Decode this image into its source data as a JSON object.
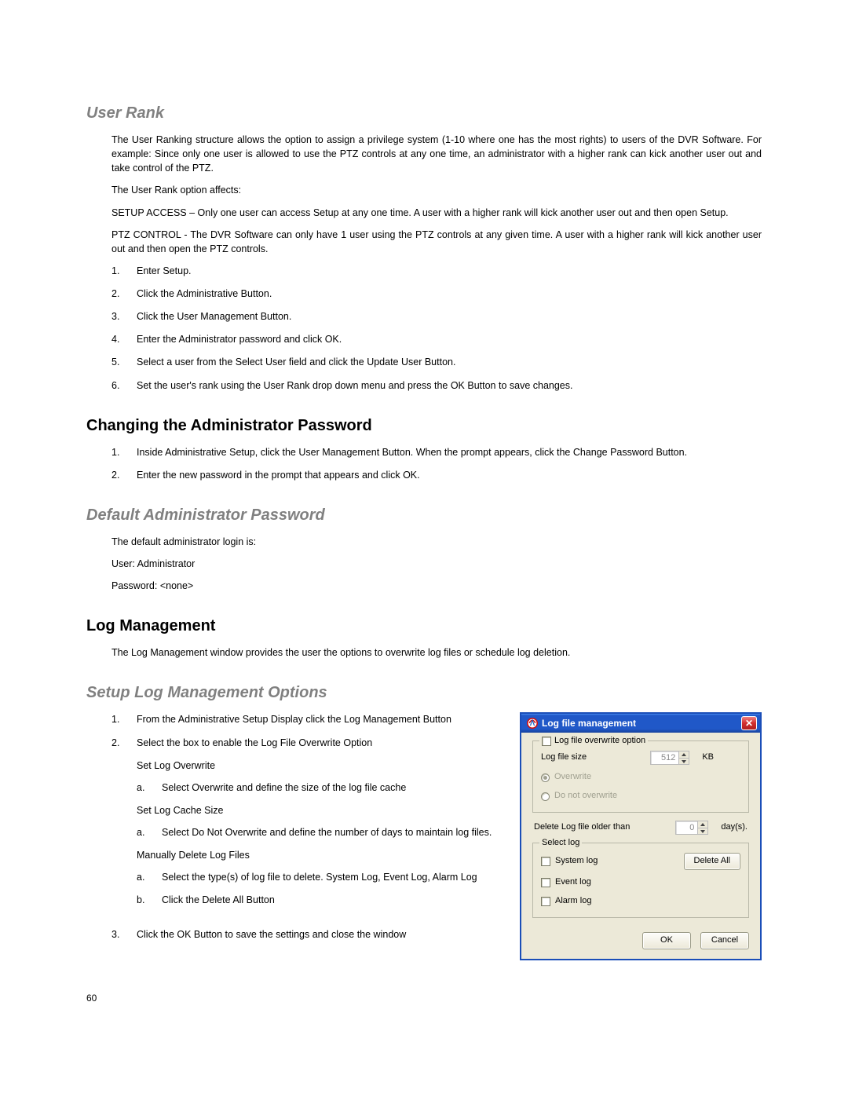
{
  "pageNumber": "60",
  "userRank": {
    "heading": "User Rank",
    "p1": "The User Ranking structure allows the option to assign a privilege system (1-10 where one has the most rights) to users of the DVR Software.  For example: Since only one user is allowed to use the PTZ controls at any one time, an administrator with a higher rank can kick another user out and take control of the PTZ.",
    "p2": "The User Rank option affects:",
    "p3": "SETUP ACCESS – Only one user can access Setup at any one time.  A user with a higher rank will kick another user out and then open Setup.",
    "p4": "PTZ CONTROL - The DVR Software can only have 1 user using the PTZ controls at any given time.  A user with a higher rank will kick another user out and then open the PTZ controls.",
    "steps": [
      "Enter Setup.",
      "Click the Administrative Button.",
      "Click the User Management Button.",
      "Enter the Administrator password and click OK.",
      "Select a user from the Select User field and click the Update User Button.",
      "Set the user's rank using the User Rank drop down menu and press the OK Button to save changes."
    ]
  },
  "changePwd": {
    "heading": "Changing the Administrator Password",
    "steps": [
      "Inside Administrative Setup, click the User Management Button. When the prompt appears, click the Change Password Button.",
      "Enter the new password in the prompt that appears and click OK."
    ]
  },
  "defaultPwd": {
    "heading": "Default Administrator Password",
    "p1": "The default administrator login is:",
    "p2": "User: Administrator",
    "p3": "Password: <none>"
  },
  "logMgmt": {
    "heading": "Log Management",
    "p1": "The Log Management window provides the user the options to overwrite log files or schedule log deletion."
  },
  "setupLog": {
    "heading": "Setup Log Management Options",
    "s1": "From the Administrative Setup Display click the Log Management Button",
    "s2": "Select the box to enable the Log File Overwrite Option",
    "lbl1": "Set Log Overwrite",
    "s1a": "Select Overwrite and define the size of the log file cache",
    "lbl2": "Set Log Cache Size",
    "s2a": "Select Do Not Overwrite and define the number of days to maintain log files.",
    "lbl3": "Manually Delete Log Files",
    "s3a": "Select the type(s) of log file to delete.  System Log, Event Log, Alarm Log",
    "s3b": "Click the Delete All Button",
    "s3": "Click the OK Button to save the settings and close the window"
  },
  "dialog": {
    "title": "Log file management",
    "group1": "Log file overwrite option",
    "logFileSize": "Log file size",
    "sizeVal": "512",
    "kb": "KB",
    "overwrite": "Overwrite",
    "doNot": "Do not overwrite",
    "deleteOlder": "Delete Log file older than",
    "daysVal": "0",
    "days": "day(s).",
    "selectLog": "Select log",
    "systemLog": "System log",
    "eventLog": "Event log",
    "alarmLog": "Alarm log",
    "deleteAll": "Delete All",
    "ok": "OK",
    "cancel": "Cancel"
  }
}
